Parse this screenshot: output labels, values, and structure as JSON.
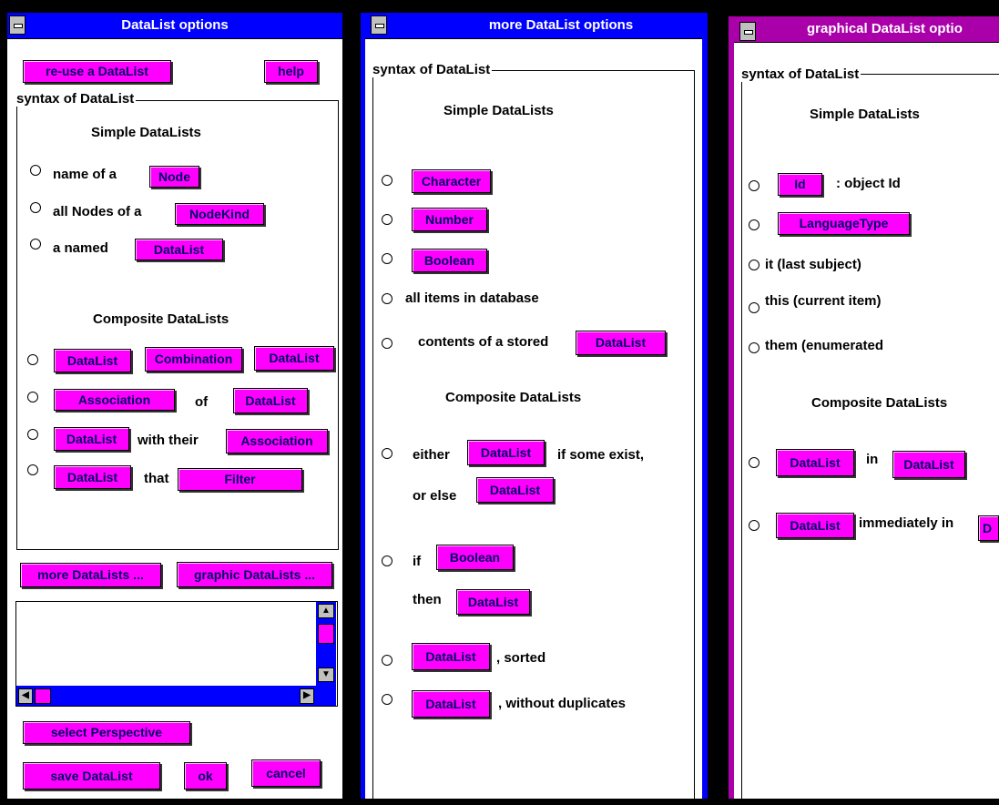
{
  "windows": {
    "w1": {
      "title": "DataList options",
      "reuse_button": "re-use a DataList",
      "help_button": "help",
      "group_label": "syntax of DataList",
      "simple_heading": "Simple DataLists",
      "opt1": {
        "text": "name of a",
        "btn": "Node"
      },
      "opt2": {
        "text": "all Nodes of a",
        "btn": "NodeKind"
      },
      "opt3": {
        "text": "a named",
        "btn": "DataList"
      },
      "composite_heading": "Composite DataLists",
      "c1": {
        "btn1": "DataList",
        "btn2": "Combination",
        "btn3": "DataList"
      },
      "c2": {
        "btn1": "Association",
        "text": "of",
        "btn2": "DataList"
      },
      "c3": {
        "btn1": "DataList",
        "text": "with their",
        "btn2": "Association"
      },
      "c4": {
        "btn1": "DataList",
        "text": "that",
        "btn2": "Filter"
      },
      "more_button": "more DataLists ...",
      "graphic_button": "graphic DataLists ...",
      "perspective_button": "select Perspective",
      "save_button": "save DataList",
      "ok_button": "ok",
      "cancel_button": "cancel"
    },
    "w2": {
      "title": "more DataList options",
      "group_label": "syntax of DataList",
      "simple_heading": "Simple DataLists",
      "o1": "Character",
      "o2": "Number",
      "o3": "Boolean",
      "o4": "all items in database",
      "o5": {
        "text": "contents of a stored",
        "btn": "DataList"
      },
      "composite_heading": "Composite DataLists",
      "c1": {
        "text1": "either",
        "btn1": "DataList",
        "text2": "if some exist,",
        "text3": "or else",
        "btn2": "DataList"
      },
      "c2": {
        "text1": "if",
        "btn1": "Boolean",
        "text2": "then",
        "btn2": "DataList"
      },
      "c3": {
        "btn": "DataList",
        "text": ", sorted"
      },
      "c4": {
        "btn": "DataList",
        "text": ", without duplicates"
      }
    },
    "w3": {
      "title": "graphical DataList optio",
      "group_label": "syntax of DataList",
      "simple_heading": "Simple DataLists",
      "o1": {
        "btn": "Id",
        "text": ": object Id"
      },
      "o2": "LanguageType",
      "o3": "it (last subject)",
      "o4": "this (current item)",
      "o5": "them (enumerated",
      "composite_heading": "Composite DataLists",
      "c1": {
        "btn1": "DataList",
        "text": "in",
        "btn2": "DataList"
      },
      "c2": {
        "btn1": "DataList",
        "text": "immediately in",
        "btn2": "D"
      }
    }
  },
  "colors": {
    "w1_title": "#0000ff",
    "w2_title": "#0000ff",
    "w3_title": "#aa00aa",
    "button": "#ff00ff"
  }
}
